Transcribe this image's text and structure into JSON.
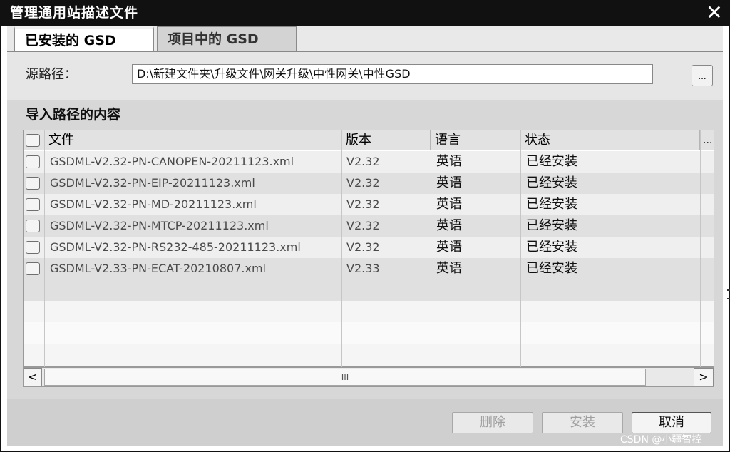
{
  "window": {
    "title": "管理通用站描述文件",
    "close_glyph": "✕"
  },
  "tabs": [
    {
      "label": "已安装的 GSD",
      "active": true
    },
    {
      "label": "项目中的 GSD",
      "active": false
    }
  ],
  "source_path": {
    "label": "源路径：",
    "value": "D:\\新建文件夹\\升级文件\\网关升级\\中性网关\\中性GSD",
    "browse_label": "..."
  },
  "content": {
    "section_title": "导入路径的内容",
    "columns": [
      "文件",
      "版本",
      "语言",
      "状态",
      "..."
    ],
    "rows": [
      {
        "file": "GSDML-V2.32-PN-CANOPEN-20211123.xml",
        "version": "V2.32",
        "language": "英语",
        "status": "已经安装"
      },
      {
        "file": "GSDML-V2.32-PN-EIP-20211123.xml",
        "version": "V2.32",
        "language": "英语",
        "status": "已经安装"
      },
      {
        "file": "GSDML-V2.32-PN-MD-20211123.xml",
        "version": "V2.32",
        "language": "英语",
        "status": "已经安装"
      },
      {
        "file": "GSDML-V2.32-PN-MTCP-20211123.xml",
        "version": "V2.32",
        "language": "英语",
        "status": "已经安装"
      },
      {
        "file": "GSDML-V2.32-PN-RS232-485-20211123.xml",
        "version": "V2.32",
        "language": "英语",
        "status": "已经安装"
      },
      {
        "file": "GSDML-V2.33-PN-ECAT-20210807.xml",
        "version": "V2.33",
        "language": "英语",
        "status": "已经安装"
      }
    ],
    "scrollbar": {
      "left": "<",
      "right": ">",
      "thumb_grip": "III"
    }
  },
  "buttons": {
    "delete": "删除",
    "install": "安装",
    "cancel": "取消"
  },
  "watermark": "CSDN @小疆智控",
  "colors": {
    "titlebar": "#111111",
    "pane": "#d7d7d7",
    "disabled_text": "#a0a0a0"
  }
}
